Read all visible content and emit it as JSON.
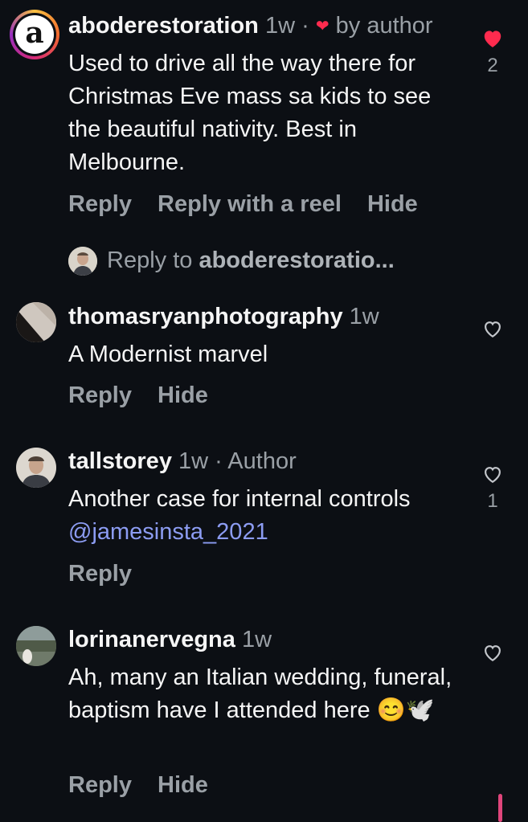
{
  "comments": [
    {
      "username": "aboderestoration",
      "time": "1w",
      "separator": "·",
      "badge": "by author",
      "text": "Used to drive all the way there for Christmas Eve mass sa kids to see the beautiful nativity. Best in Melbourne.",
      "liked": true,
      "like_count": "2",
      "actions": [
        "Reply",
        "Reply with a reel",
        "Hide"
      ],
      "avatar_letter": "a"
    },
    {
      "username": "thomasryanphotography",
      "time": "1w",
      "text": "A Modernist marvel",
      "liked": false,
      "like_count": "",
      "actions": [
        "Reply",
        "Hide"
      ]
    },
    {
      "username": "tallstorey",
      "time": "1w",
      "separator": "·",
      "badge": "Author",
      "text_before_mention": "Another case for internal controls ",
      "mention": "@jamesinsta_2021",
      "liked": false,
      "like_count": "1",
      "actions": [
        "Reply"
      ]
    },
    {
      "username": "lorinanervegna",
      "time": "1w",
      "text": "Ah, many an Italian wedding, funeral, baptism have I attended here 😊🕊️",
      "liked": false,
      "like_count": "",
      "actions": [
        "Reply",
        "Hide"
      ]
    }
  ],
  "reply_prompt": {
    "prefix": "Reply to ",
    "target": "aboderestoratio..."
  },
  "colors": {
    "background": "#0c0f14",
    "liked_heart": "#ff2b4e",
    "mention": "#8c9cf2",
    "muted": "#9aa0a6"
  }
}
